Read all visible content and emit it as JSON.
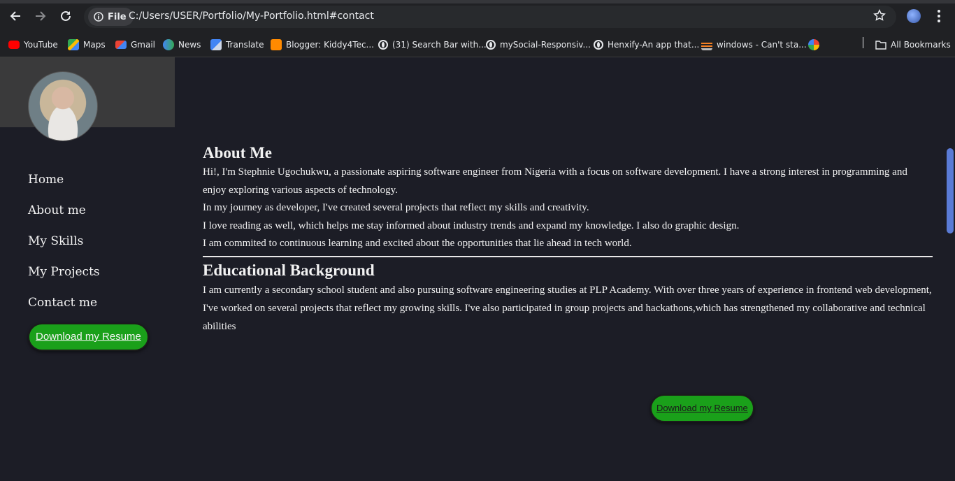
{
  "browser": {
    "scheme_chip": "File",
    "url": "C:/Users/USER/Portfolio/My-Portfolio.html#contact",
    "bookmarks": [
      {
        "label": "YouTube",
        "icon": "youtube-icon"
      },
      {
        "label": "Maps",
        "icon": "maps-icon"
      },
      {
        "label": "Gmail",
        "icon": "gmail-icon"
      },
      {
        "label": "News",
        "icon": "news-icon"
      },
      {
        "label": "Translate",
        "icon": "translate-icon"
      },
      {
        "label": "Blogger: Kiddy4Tec...",
        "icon": "blogger-icon"
      },
      {
        "label": "(31) Search Bar with...",
        "icon": "globe-icon"
      },
      {
        "label": "mySocial-Responsiv...",
        "icon": "globe-icon"
      },
      {
        "label": "Henxify-An app that...",
        "icon": "globe-icon"
      },
      {
        "label": "windows - Can't sta...",
        "icon": "stackoverflow-icon"
      },
      {
        "label": "",
        "icon": "google-icon"
      }
    ],
    "all_bookmarks": "All Bookmarks"
  },
  "sidebar": {
    "nav": [
      "Home",
      "About me",
      "My Skills",
      "My Projects",
      "Contact me"
    ],
    "resume_button": "Download my Resume"
  },
  "about": {
    "heading": "About Me",
    "paragraphs": [
      "Hi!, I'm Stephnie Ugochukwu, a passionate aspiring software engineer from Nigeria with a focus on software development. I have a strong interest in programming and enjoy exploring various aspects of technology.",
      "In my journey as developer, I've created several projects that reflect my skills and creativity.",
      "I love reading as well, which helps me stay informed about industry trends and expand my knowledge. I also do graphic design.",
      "I am commited to continuous learning and excited about the opportunities that lie ahead in tech world."
    ]
  },
  "education": {
    "heading": "Educational Background",
    "text": "I am currently a secondary school student and also pursuing software engineering studies at PLP Academy. With over three years of experience in frontend web development, I've worked on several projects that reflect my growing skills. I've also participated in group projects and hackathons,which has strengthened my collaborative and technical abilities"
  },
  "main_resume_button": "Download my Resume",
  "colors": {
    "page_bg": "#1c1d26",
    "button_green": "#1aa01a",
    "chrome_bg": "#202124",
    "scrollbar_thumb": "#5a7bd6"
  }
}
